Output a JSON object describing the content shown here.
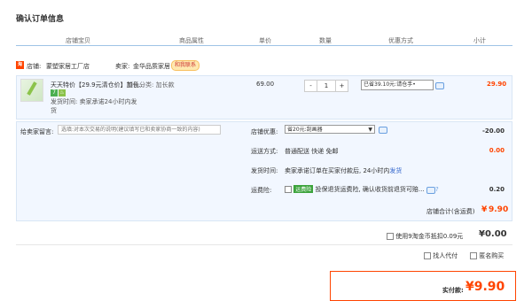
{
  "page_title": "确认订单信息",
  "columns": [
    "店铺宝贝",
    "商品属性",
    "单价",
    "数量",
    "优惠方式",
    "小计"
  ],
  "shop": {
    "icon_text": "淘",
    "label": "店铺:",
    "name": "蒙塑家居工厂店",
    "seller_label": "卖家:",
    "seller_name": "金华品质家居",
    "contact_label": "和我联系"
  },
  "item": {
    "name": "天天特价【29.9元清仓价】加长...",
    "attr": "颜色分类: 加长款",
    "badge1": "7",
    "badge2": "♨",
    "ship_line1": "发货时间: 卖家承诺24小时内发",
    "ship_line2": "货",
    "price": "69.00",
    "qty_minus": "-",
    "qty": "1",
    "qty_plus": "+",
    "promo": "已省39.10元:请仓手•",
    "subtotal": "29.90"
  },
  "message": {
    "label": "给卖家留言:",
    "placeholder": "选填:对本次交易的说明(建议填写已和卖家协商一致的内容)"
  },
  "discount": {
    "label": "店铺优惠:",
    "value": "省20元:刮画器",
    "amount": "-20.00"
  },
  "shipping": {
    "label": "运送方式:",
    "value": "普通配送 快递 免邮",
    "amount": "0.00"
  },
  "delivery": {
    "label": "发货时间:",
    "value": "卖家承诺订单在买家付款后, 24小时内",
    "link": "发货"
  },
  "insurance": {
    "label": "运费险:",
    "tag": "运费险",
    "value": "投保退货运费险, 确认收货前退货可赔...",
    "amount": "0.20"
  },
  "store_total": {
    "label": "店铺合计(含运费)",
    "currency": "¥",
    "amount": "9.90"
  },
  "coins": {
    "label": "使用9淘金币抵扣0.09元",
    "amount": "¥0.00"
  },
  "options": {
    "anon_pay": "找人代付",
    "anon_buy": "匿名购买"
  },
  "pay": {
    "label": "实付款:",
    "amount": "¥9.90"
  },
  "colors": {
    "accent": "#ff4400",
    "link": "#3366cc",
    "row_bg": "#f2f7ff"
  }
}
